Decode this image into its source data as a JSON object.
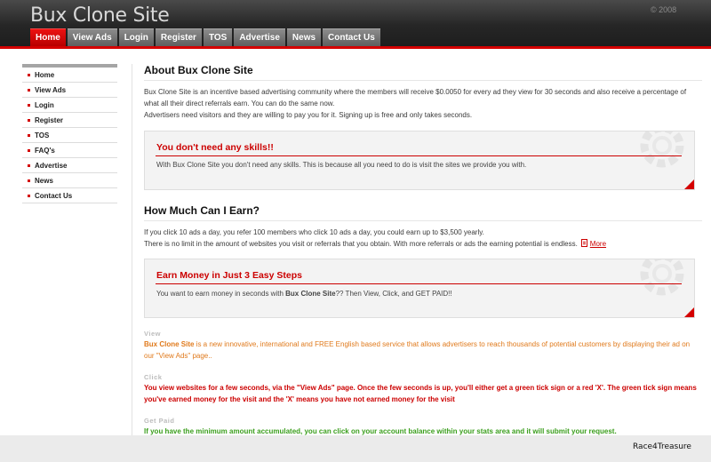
{
  "header": {
    "site_title": "Bux Clone Site",
    "copyright": "© 2008"
  },
  "nav": {
    "items": [
      "Home",
      "View Ads",
      "Login",
      "Register",
      "TOS",
      "Advertise",
      "News",
      "Contact Us"
    ],
    "active": "Home"
  },
  "sidebar": {
    "items": [
      "Home",
      "View Ads",
      "Login",
      "Register",
      "TOS",
      "FAQ's",
      "Advertise",
      "News",
      "Contact Us"
    ]
  },
  "about": {
    "heading": "About Bux Clone Site",
    "para1": "Bux Clone Site is an incentive based advertising community where the members will receive $0.0050 for every ad they view for 30 seconds and also receive a percentage of what all their direct referrals earn. You can do the same now.",
    "para2": "Advertisers need visitors and they are willing to pay you for it. Signing up is free and only takes seconds."
  },
  "skills_box": {
    "title": "You don't need any skills!!",
    "text": "With Bux Clone Site you don't need any skills. This is because all you need to do is visit the sites we provide you with."
  },
  "earn": {
    "heading": "How Much Can I Earn?",
    "para1": "If you click 10 ads a day, you refer 100 members who click 10 ads a day, you could earn up to $3,500 yearly.",
    "para2": "There is no limit in the amount of websites you visit or referrals that you obtain. With more referrals or ads the earning potential is endless.",
    "more_link": "More"
  },
  "steps_box": {
    "title": "Earn Money in Just 3 Easy Steps",
    "text_before": "You want to earn money in seconds with ",
    "text_bold": "Bux Clone Site",
    "text_after": "?? Then View, Click, and GET PAID!!"
  },
  "steps": {
    "view_label": "View",
    "view_bold": "Bux Clone Site",
    "view_text": " is a new innovative, international and FREE English based service that allows advertisers to reach thousands of potential customers by displaying their ad on our \"View Ads\" page..",
    "click_label": "Click",
    "click_text": "You view websites for a few seconds, via the \"View Ads\" page. Once the few seconds is up, you'll either get a green tick sign or a red 'X'. The green tick sign means you've earned money for the visit and the 'X' means you have not earned money for the visit",
    "paid_label": "Get Paid",
    "paid_text": "If you have the minimum amount accumulated, you can click on your account balance within your stats area and it will submit your request."
  },
  "footer": {
    "watermark": "Race4Treasure"
  },
  "colors": {
    "accent": "#d40000",
    "header_dark": "#262626",
    "orange_text": "#e07a1c",
    "green_text": "#3a9e1c"
  }
}
